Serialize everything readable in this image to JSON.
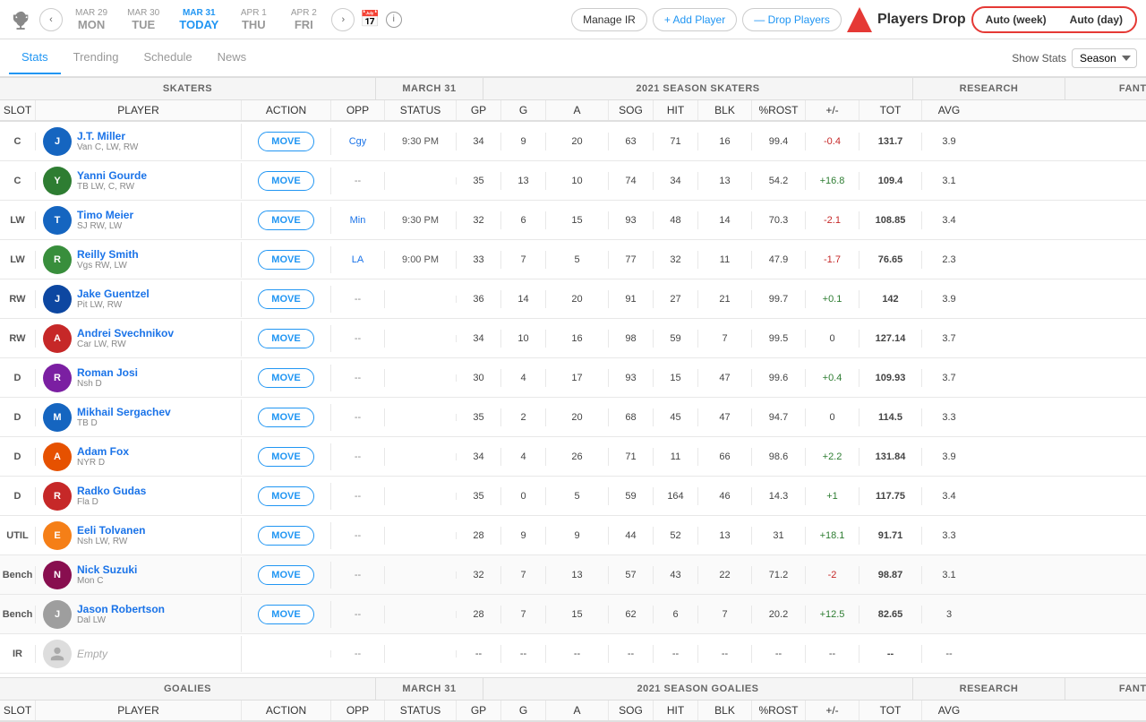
{
  "nav": {
    "days": [
      {
        "date": "MAR 29",
        "dow": "MON",
        "today": false
      },
      {
        "date": "MAR 30",
        "dow": "TUE",
        "today": false
      },
      {
        "date": "MAR 31",
        "dow": "TODAY",
        "today": true
      },
      {
        "date": "APR 1",
        "dow": "THU",
        "today": false
      },
      {
        "date": "APR 2",
        "dow": "FRI",
        "today": false
      }
    ],
    "buttons": {
      "manage_ir": "Manage IR",
      "add_player": "+ Add Player",
      "drop_players": "— Drop Players",
      "auto_week": "Auto (week)",
      "auto_day": "Auto (day)"
    }
  },
  "tabs": {
    "items": [
      "Stats",
      "Trending",
      "Schedule",
      "News"
    ],
    "active": "Stats",
    "show_stats_label": "Show Stats",
    "season_label": "Season"
  },
  "skaters_section": {
    "title": "SKATERS",
    "date": "MARCH 31",
    "season_header": "2021 SEASON SKATERS",
    "research_header": "RESEARCH",
    "fantasy_pts_header": "FANTASY PTS"
  },
  "col_headers": {
    "slot": "SLOT",
    "player": "PLAYER",
    "action": "ACTION",
    "opp": "OPP",
    "status": "STATUS",
    "gp": "GP",
    "g": "G",
    "a": "A",
    "sog": "SOG",
    "hit": "HIT",
    "blk": "BLK",
    "pct_rost": "%ROST",
    "plus_minus": "+/-",
    "tot": "TOT",
    "avg": "AVG"
  },
  "players": [
    {
      "slot": "C",
      "name": "J.T. Miller",
      "team": "Van  C, LW, RW",
      "opp": "Cgy",
      "status": "9:30 PM",
      "gp": 34,
      "g": 9,
      "a": 20,
      "sog": 63,
      "hit": 71,
      "blk": 16,
      "pct_rost": 99.4,
      "plus_minus": "-0.4",
      "pm_class": "negative",
      "tot": 131.7,
      "avg": 3.9,
      "action": "MOVE",
      "bench": false,
      "ir": false
    },
    {
      "slot": "C",
      "name": "Yanni Gourde",
      "team": "TB  LW, C, RW",
      "opp": "--",
      "status": "",
      "gp": 35,
      "g": 13,
      "a": 10,
      "sog": 74,
      "hit": 34,
      "blk": 13,
      "pct_rost": 54.2,
      "plus_minus": "+16.8",
      "pm_class": "positive",
      "tot": 109.4,
      "avg": 3.1,
      "action": "MOVE",
      "bench": false,
      "ir": false
    },
    {
      "slot": "LW",
      "name": "Timo Meier",
      "team": "SJ  RW, LW",
      "opp": "Min",
      "status": "9:30 PM",
      "gp": 32,
      "g": 6,
      "a": 15,
      "sog": 93,
      "hit": 48,
      "blk": 14,
      "pct_rost": 70.3,
      "plus_minus": "-2.1",
      "pm_class": "negative",
      "tot": 108.85,
      "avg": 3.4,
      "action": "MOVE",
      "bench": false,
      "ir": false
    },
    {
      "slot": "LW",
      "name": "Reilly Smith",
      "team": "Vgs  RW, LW",
      "opp": "LA",
      "status": "9:00 PM",
      "gp": 33,
      "g": 7,
      "a": 5,
      "sog": 77,
      "hit": 32,
      "blk": 11,
      "pct_rost": 47.9,
      "plus_minus": "-1.7",
      "pm_class": "negative",
      "tot": 76.65,
      "avg": 2.3,
      "action": "MOVE",
      "bench": false,
      "ir": false
    },
    {
      "slot": "RW",
      "name": "Jake Guentzel",
      "team": "Pit  LW, RW",
      "opp": "--",
      "status": "",
      "gp": 36,
      "g": 14,
      "a": 20,
      "sog": 91,
      "hit": 27,
      "blk": 21,
      "pct_rost": 99.7,
      "plus_minus": "+0.1",
      "pm_class": "positive",
      "tot": 142.0,
      "avg": 3.9,
      "action": "MOVE",
      "bench": false,
      "ir": false
    },
    {
      "slot": "RW",
      "name": "Andrei Svechnikov",
      "team": "Car  LW, RW",
      "opp": "--",
      "status": "",
      "gp": 34,
      "g": 10,
      "a": 16,
      "sog": 98,
      "hit": 59,
      "blk": 7,
      "pct_rost": 99.5,
      "plus_minus": "0",
      "pm_class": "neutral",
      "tot": 127.14,
      "avg": 3.7,
      "action": "MOVE",
      "bench": false,
      "ir": false
    },
    {
      "slot": "D",
      "name": "Roman Josi",
      "team": "Nsh  D",
      "opp": "--",
      "status": "",
      "gp": 30,
      "g": 4,
      "a": 17,
      "sog": 93,
      "hit": 15,
      "blk": 47,
      "pct_rost": 99.6,
      "plus_minus": "+0.4",
      "pm_class": "positive",
      "tot": 109.93,
      "avg": 3.7,
      "action": "MOVE",
      "bench": false,
      "ir": false
    },
    {
      "slot": "D",
      "name": "Mikhail Sergachev",
      "team": "TB  D",
      "opp": "--",
      "status": "",
      "gp": 35,
      "g": 2,
      "a": 20,
      "sog": 68,
      "hit": 45,
      "blk": 47,
      "pct_rost": 94.7,
      "plus_minus": "0",
      "pm_class": "neutral",
      "tot": 114.5,
      "avg": 3.3,
      "action": "MOVE",
      "bench": false,
      "ir": false
    },
    {
      "slot": "D",
      "name": "Adam Fox",
      "team": "NYR  D",
      "opp": "--",
      "status": "",
      "gp": 34,
      "g": 4,
      "a": 26,
      "sog": 71,
      "hit": 11,
      "blk": 66,
      "pct_rost": 98.6,
      "plus_minus": "+2.2",
      "pm_class": "positive",
      "tot": 131.84,
      "avg": 3.9,
      "action": "MOVE",
      "bench": false,
      "ir": false
    },
    {
      "slot": "D",
      "name": "Radko Gudas",
      "team": "Fla  D",
      "opp": "--",
      "status": "",
      "gp": 35,
      "g": 0,
      "a": 5,
      "sog": 59,
      "hit": 164,
      "blk": 46,
      "pct_rost": 14.3,
      "plus_minus": "+1",
      "pm_class": "positive",
      "tot": 117.75,
      "avg": 3.4,
      "action": "MOVE",
      "bench": false,
      "ir": false
    },
    {
      "slot": "UTIL",
      "name": "Eeli Tolvanen",
      "team": "Nsh  LW, RW",
      "opp": "--",
      "status": "",
      "gp": 28,
      "g": 9,
      "a": 9,
      "sog": 44,
      "hit": 52,
      "blk": 13,
      "pct_rost": 31.0,
      "plus_minus": "+18.1",
      "pm_class": "positive",
      "tot": 91.71,
      "avg": 3.3,
      "action": "MOVE",
      "bench": false,
      "ir": false
    },
    {
      "slot": "Bench",
      "name": "Nick Suzuki",
      "team": "Mon  C",
      "opp": "--",
      "status": "",
      "gp": 32,
      "g": 7,
      "a": 13,
      "sog": 57,
      "hit": 43,
      "blk": 22,
      "pct_rost": 71.2,
      "plus_minus": "-2",
      "pm_class": "negative",
      "tot": 98.87,
      "avg": 3.1,
      "action": "MOVE",
      "bench": true,
      "ir": false
    },
    {
      "slot": "Bench",
      "name": "Jason Robertson",
      "team": "Dal  LW",
      "opp": "--",
      "status": "",
      "gp": 28,
      "g": 7,
      "a": 15,
      "sog": 62,
      "hit": 6,
      "blk": 7,
      "pct_rost": 20.2,
      "plus_minus": "+12.5",
      "pm_class": "positive",
      "tot": 82.65,
      "avg": 3.0,
      "action": "MOVE",
      "bench": true,
      "ir": false
    },
    {
      "slot": "IR",
      "name": "Empty",
      "team": "",
      "opp": "--",
      "status": "",
      "gp": "--",
      "g": "--",
      "a": "--",
      "sog": "--",
      "hit": "--",
      "blk": "--",
      "pct_rost": "--",
      "plus_minus": "--",
      "pm_class": "neutral",
      "tot": "--",
      "avg": "--",
      "action": "",
      "bench": false,
      "ir": true,
      "empty": true
    }
  ],
  "goalies_section": {
    "title": "GOALIES",
    "date": "MARCH 31",
    "season_header": "2021 SEASON GOALIES",
    "research_header": "RESEARCH",
    "fantasy_pts_header": "FANTASY PTS"
  },
  "players_drop": {
    "label": "Players Drop"
  }
}
